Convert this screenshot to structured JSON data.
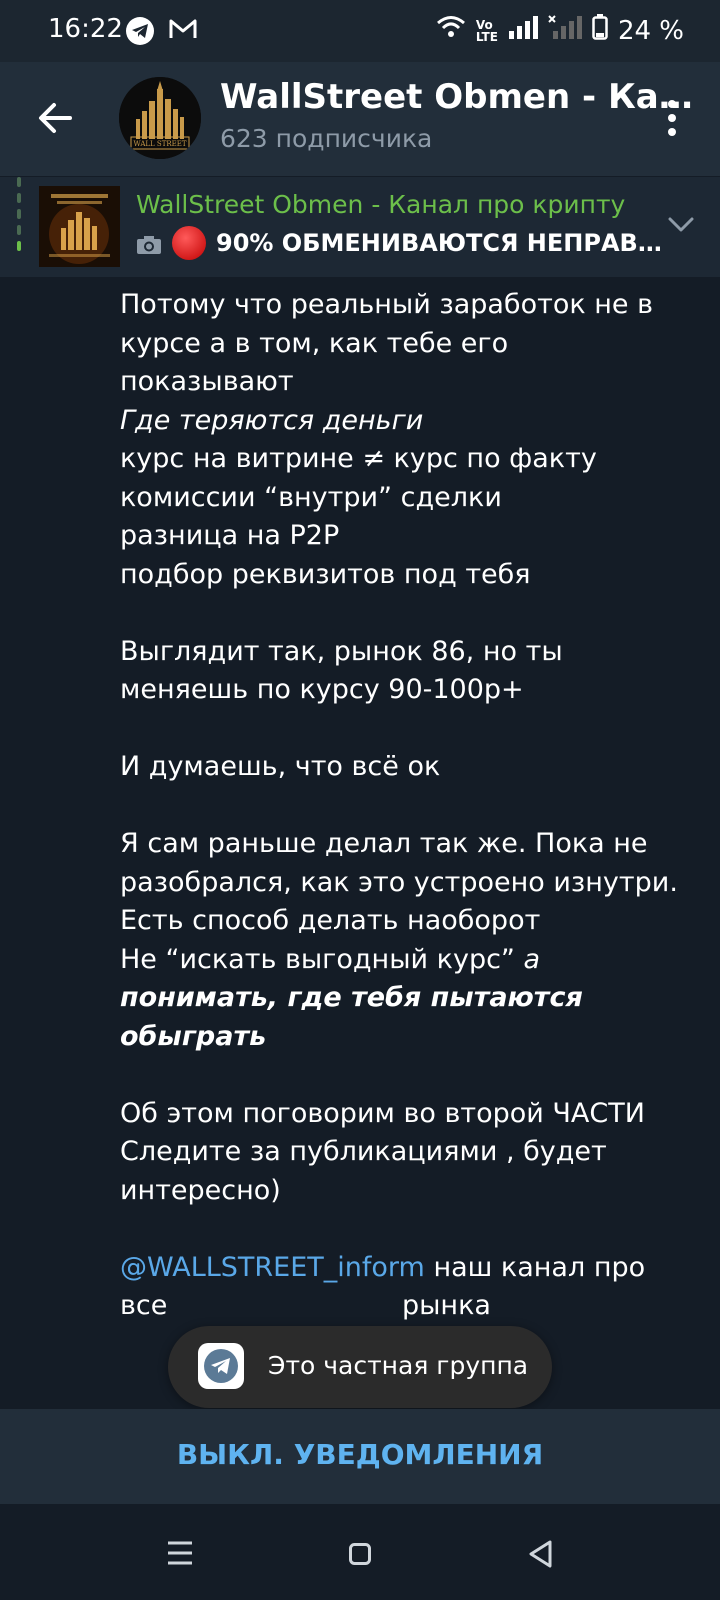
{
  "status_bar": {
    "time": "16:22",
    "battery": "24 %",
    "icons": [
      "telegram-icon",
      "gmail-icon",
      "wifi-icon",
      "volte-icon",
      "signal-icon",
      "no-signal-icon",
      "battery-icon"
    ]
  },
  "header": {
    "channel_name": "WallStreet Obmen - Ка…",
    "subscribers": "623 подписчика"
  },
  "pinned": {
    "title": "WallStreet Obmen - Канал про крипту",
    "text": "90% ОБМЕНИВАЮТСЯ НЕПРАВ…"
  },
  "message": {
    "paragraphs": [
      "Потому что реальный заработок не в курсе а в том, как тебе его показывают",
      "Где теряются деньги",
      "курс на витрине ≠ курс по факту",
      "комиссии “внутри” сделки",
      "разница на P2P",
      "подбор реквизитов под тебя",
      "",
      "Выглядит так, рынок 86, но ты меняешь по курсу 90-100р+",
      "",
      "И думаешь, что всё ок",
      "",
      "Я сам раньше делал так же. Пока не разобрался, как это устроено изнутри.",
      "Есть способ делать наоборот",
      "Не “искать выгодный курс”",
      " а",
      "понимать, где тебя пытаются обыграть",
      "",
      "Об этом поговорим во второй ЧАСТИ",
      "Следите за публикациями , будет интересно)",
      "",
      "@WALLSTREET_inform",
      " наш канал про все",
      "рынка"
    ]
  },
  "toast": {
    "text": "Это частная группа"
  },
  "bottom": {
    "mute_label": "ВЫКЛ. УВЕДОМЛЕНИЯ"
  },
  "colors": {
    "accent": "#5fb3f0",
    "pinned_title": "#6cbf4a",
    "link": "#5aa8e8",
    "background": "#141c26"
  }
}
